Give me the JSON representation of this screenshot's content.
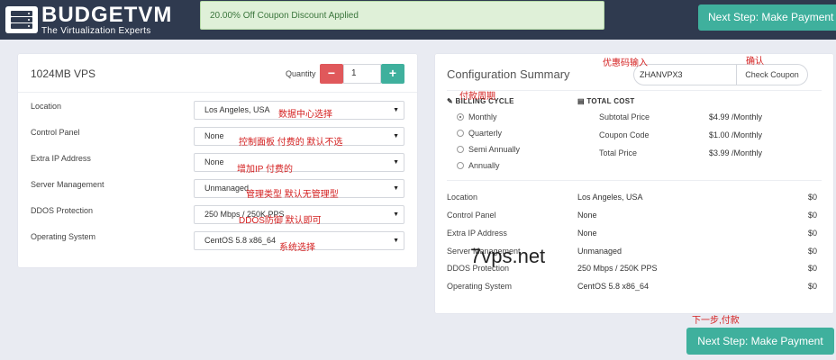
{
  "brand": {
    "name": "BUDGETVM",
    "tagline": "The Virtualization Experts"
  },
  "alert": {
    "text": "20.00% Off Coupon Discount Applied"
  },
  "buttons": {
    "next_step": "Next Step: Make Payment"
  },
  "product": {
    "title": "1024MB VPS",
    "quantity_label": "Quantity",
    "quantity_value": "1",
    "minus": "−",
    "plus": "+"
  },
  "options": [
    {
      "label": "Location",
      "value": "Los Angeles, USA",
      "note": "数据中心选择"
    },
    {
      "label": "Control Panel",
      "value": "None",
      "note": "控制面板 付费的  默认不选"
    },
    {
      "label": "Extra IP Address",
      "value": "None",
      "note": "增加IP  付费的"
    },
    {
      "label": "Server Management",
      "value": "Unmanaged",
      "note": "管理类型  默认无管理型"
    },
    {
      "label": "DDOS Protection",
      "value": "250 Mbps / 250K PPS",
      "note": "DDOS防御  默认即可"
    },
    {
      "label": "Operating System",
      "value": "CentOS 5.8 x86_64",
      "note": "系统选择"
    }
  ],
  "summary": {
    "title": "Configuration Summary",
    "coupon_code": "ZHANVPX3",
    "check_coupon": "Check Coupon",
    "billing_cycle_head": "BILLING CYCLE",
    "cycles": [
      "Monthly",
      "Quarterly",
      "Semi Annually",
      "Annually"
    ],
    "selected_cycle": "Monthly",
    "total_cost_head": "TOTAL COST",
    "prices": [
      {
        "label": "Subtotal Price",
        "value": "$4.99 /Monthly"
      },
      {
        "label": "Coupon Code",
        "value": "$1.00 /Monthly"
      },
      {
        "label": "Total Price",
        "value": "$3.99 /Monthly"
      }
    ],
    "items": [
      {
        "label": "Location",
        "value": "Los Angeles, USA",
        "price": "$0"
      },
      {
        "label": "Control Panel",
        "value": "None",
        "price": "$0"
      },
      {
        "label": "Extra IP Address",
        "value": "None",
        "price": "$0"
      },
      {
        "label": "Server Management",
        "value": "Unmanaged",
        "price": "$0"
      },
      {
        "label": "DDOS Protection",
        "value": "250 Mbps / 250K PPS",
        "price": "$0"
      },
      {
        "label": "Operating System",
        "value": "CentOS 5.8 x86_64",
        "price": "$0"
      }
    ]
  },
  "annotations": {
    "coupon_input": "优惠码输入",
    "confirm": "确认",
    "billing_cycle": "付款周期",
    "next_pay": "下一步,付款"
  },
  "watermark": "7vps.net",
  "colors": {
    "topbar": "#2f3a4f",
    "accent": "#3fb09d",
    "minus": "#e0585b",
    "alert_bg": "#dff0d8",
    "note": "#d42020"
  }
}
